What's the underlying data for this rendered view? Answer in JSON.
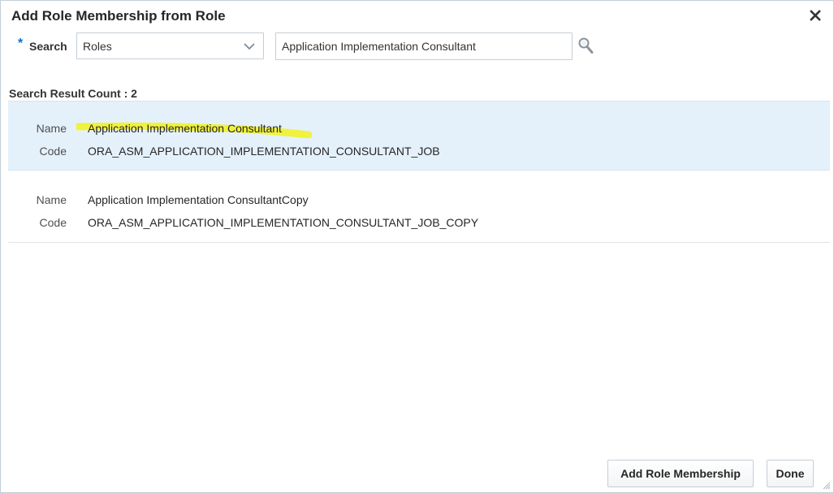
{
  "dialog": {
    "title": "Add Role Membership from Role"
  },
  "search": {
    "required_mark": "*",
    "label": "Search",
    "category_value": "Roles",
    "query_value": "Application Implementation Consultant"
  },
  "results": {
    "count_text": "Search Result Count : 2",
    "name_label": "Name",
    "code_label": "Code",
    "items": [
      {
        "name": "Application Implementation Consultant",
        "code": "ORA_ASM_APPLICATION_IMPLEMENTATION_CONSULTANT_JOB",
        "selected": true
      },
      {
        "name": "Application Implementation ConsultantCopy",
        "code": "ORA_ASM_APPLICATION_IMPLEMENTATION_CONSULTANT_JOB_COPY",
        "selected": false
      }
    ]
  },
  "actions": {
    "add_label": "Add Role Membership",
    "done_label": "Done"
  },
  "icons": {
    "close": "close-icon",
    "dropdown": "chevron-down-icon",
    "search": "magnifier-icon",
    "resize": "resize-grip-icon"
  },
  "colors": {
    "selected_row": "#e4f1fb",
    "highlighter": "#f2f21c",
    "required": "#0572ce"
  }
}
